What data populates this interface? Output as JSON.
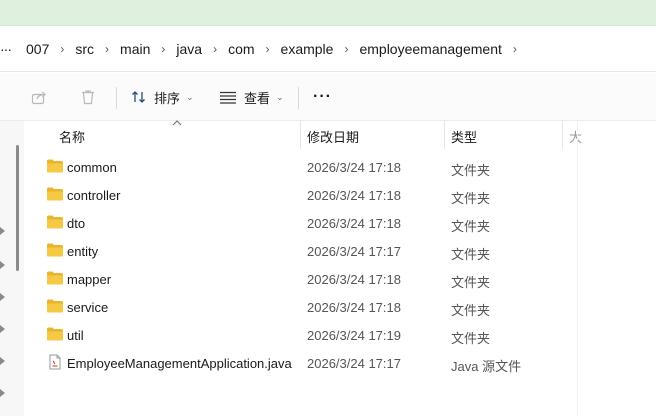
{
  "breadcrumb": {
    "more": "···",
    "items": [
      "007",
      "src",
      "main",
      "java",
      "com",
      "example",
      "employeemanagement"
    ]
  },
  "toolbar": {
    "sort_label": "排序",
    "view_label": "查看",
    "more_label": "···"
  },
  "columns": {
    "name": "名称",
    "date": "修改日期",
    "type": "类型",
    "size": "大"
  },
  "files": [
    {
      "name": "common",
      "date": "2026/3/24 17:18",
      "type": "文件夹",
      "icon": "folder-icon"
    },
    {
      "name": "controller",
      "date": "2026/3/24 17:18",
      "type": "文件夹",
      "icon": "folder-icon"
    },
    {
      "name": "dto",
      "date": "2026/3/24 17:18",
      "type": "文件夹",
      "icon": "folder-icon"
    },
    {
      "name": "entity",
      "date": "2026/3/24 17:17",
      "type": "文件夹",
      "icon": "folder-icon"
    },
    {
      "name": "mapper",
      "date": "2026/3/24 17:18",
      "type": "文件夹",
      "icon": "folder-icon"
    },
    {
      "name": "service",
      "date": "2026/3/24 17:18",
      "type": "文件夹",
      "icon": "folder-icon"
    },
    {
      "name": "util",
      "date": "2026/3/24 17:19",
      "type": "文件夹",
      "icon": "folder-icon"
    },
    {
      "name": "EmployeeManagementApplication.java",
      "date": "2026/3/24 17:17",
      "type": "Java 源文件",
      "icon": "java-file-icon"
    }
  ],
  "colors": {
    "top_strip": "#dff0de",
    "folder": "#f6c944",
    "folder_dark": "#e8b52e"
  }
}
